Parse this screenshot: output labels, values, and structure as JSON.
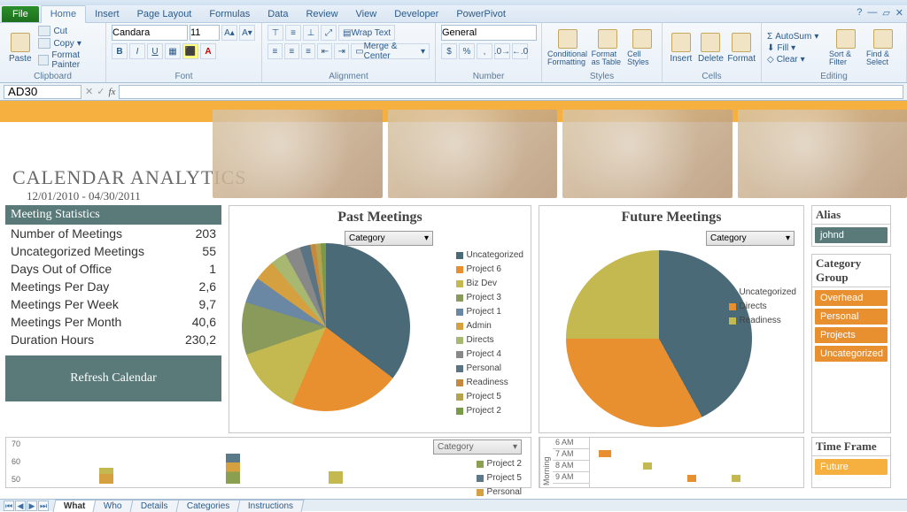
{
  "ribbon": {
    "tabs": [
      "File",
      "Home",
      "Insert",
      "Page Layout",
      "Formulas",
      "Data",
      "Review",
      "View",
      "Developer",
      "PowerPivot"
    ],
    "active_tab": "Home",
    "clipboard": {
      "label": "Clipboard",
      "paste": "Paste",
      "cut": "Cut",
      "copy": "Copy",
      "painter": "Format Painter"
    },
    "font": {
      "label": "Font",
      "name": "Candara",
      "size": "11"
    },
    "alignment": {
      "label": "Alignment",
      "wrap": "Wrap Text",
      "merge": "Merge & Center"
    },
    "number": {
      "label": "Number",
      "format": "General"
    },
    "styles": {
      "label": "Styles",
      "cond": "Conditional Formatting",
      "table": "Format as Table",
      "cell": "Cell Styles"
    },
    "cells": {
      "label": "Cells",
      "insert": "Insert",
      "delete": "Delete",
      "format": "Format"
    },
    "editing": {
      "label": "Editing",
      "autosum": "AutoSum",
      "fill": "Fill",
      "clear": "Clear",
      "sort": "Sort & Filter",
      "find": "Find & Select"
    }
  },
  "formula_bar": {
    "name_box": "AD30",
    "formula": ""
  },
  "banner": {
    "title": "CALENDAR ANALYTICS",
    "date_range": "12/01/2010 - 04/30/2011"
  },
  "stats": {
    "header": "Meeting Statistics",
    "rows": [
      {
        "label": "Number of Meetings",
        "value": "203"
      },
      {
        "label": "Uncategorized Meetings",
        "value": "55"
      },
      {
        "label": "Days Out of Office",
        "value": "1"
      },
      {
        "label": "Meetings Per Day",
        "value": "2,6"
      },
      {
        "label": "Meetings Per Week",
        "value": "9,7"
      },
      {
        "label": "Meetings Per Month",
        "value": "40,6"
      },
      {
        "label": "Duration Hours",
        "value": "230,2"
      }
    ],
    "refresh_label": "Refresh Calendar"
  },
  "past": {
    "title": "Past Meetings",
    "category_btn": "Category",
    "legend": [
      "Uncategorized",
      "Project 6",
      "Biz Dev",
      "Project 3",
      "Project 1",
      "Admin",
      "Directs",
      "Project 4",
      "Personal",
      "Readiness",
      "Project 5",
      "Project 2"
    ]
  },
  "future": {
    "title": "Future Meetings",
    "category_btn": "Category",
    "legend": [
      "Uncategorized",
      "Directs",
      "Readiness"
    ]
  },
  "alias": {
    "header": "Alias",
    "value": "johnd"
  },
  "catgroup": {
    "header": "Category Group",
    "items": [
      "Overhead",
      "Personal",
      "Projects",
      "Uncategorized"
    ]
  },
  "timeframe": {
    "header": "Time Frame",
    "items": [
      "Future"
    ]
  },
  "bar_lower": {
    "y_ticks": [
      "70",
      "60",
      "50"
    ],
    "category_btn": "Category",
    "legend": [
      "Project 2",
      "Project 5",
      "Personal"
    ]
  },
  "morning": {
    "label": "Morning",
    "hours": [
      "6 AM",
      "7 AM",
      "8 AM",
      "9 AM"
    ]
  },
  "sheet_tabs": [
    "What",
    "Who",
    "Details",
    "Categories",
    "Instructions"
  ],
  "active_sheet": "What",
  "chart_data": [
    {
      "type": "pie",
      "title": "Past Meetings",
      "series": [
        {
          "name": "Uncategorized",
          "value": 35,
          "color": "#4a6a78"
        },
        {
          "name": "Project 6",
          "value": 21,
          "color": "#e89030"
        },
        {
          "name": "Biz Dev",
          "value": 13,
          "color": "#c4b850"
        },
        {
          "name": "Project 3",
          "value": 10,
          "color": "#8a9a5a"
        },
        {
          "name": "Project 1",
          "value": 5,
          "color": "#6a88a4"
        },
        {
          "name": "Admin",
          "value": 4,
          "color": "#d4a040"
        },
        {
          "name": "Directs",
          "value": 3,
          "color": "#a8b870"
        },
        {
          "name": "Project 4",
          "value": 3,
          "color": "#888888"
        },
        {
          "name": "Personal",
          "value": 2,
          "color": "#5a7484"
        },
        {
          "name": "Readiness",
          "value": 1,
          "color": "#c48a40"
        },
        {
          "name": "Project 5",
          "value": 1,
          "color": "#b4a450"
        },
        {
          "name": "Project 2",
          "value": 1,
          "color": "#7a9a4a"
        }
      ]
    },
    {
      "type": "pie",
      "title": "Future Meetings",
      "series": [
        {
          "name": "Uncategorized",
          "value": 42,
          "color": "#4a6a78"
        },
        {
          "name": "Directs",
          "value": 33,
          "color": "#e89030"
        },
        {
          "name": "Readiness",
          "value": 25,
          "color": "#c4b850"
        }
      ]
    },
    {
      "type": "bar",
      "title": "",
      "ylim": [
        50,
        70
      ],
      "categories": [],
      "series": [
        {
          "name": "Project 2",
          "color": "#8aa050"
        },
        {
          "name": "Project 5",
          "color": "#5a7a8a"
        },
        {
          "name": "Personal",
          "color": "#d4a040"
        }
      ]
    }
  ],
  "colors": {
    "legend_swatches_past": [
      "#4a6a78",
      "#e89030",
      "#c4b850",
      "#8a9a5a",
      "#6a88a4",
      "#d4a040",
      "#a8b870",
      "#888888",
      "#5a7484",
      "#c48a40",
      "#b4a450",
      "#7a9a4a"
    ],
    "legend_swatches_future": [
      "#4a6a78",
      "#e89030",
      "#c4b850"
    ],
    "legend_swatches_bar": [
      "#8aa050",
      "#5a7a8a",
      "#d4a040"
    ]
  }
}
